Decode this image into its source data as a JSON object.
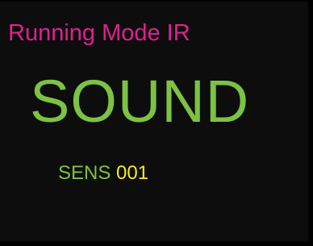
{
  "header": {
    "title": "Running Mode IR"
  },
  "main": {
    "mode_label": "SOUND"
  },
  "sensitivity": {
    "label": "SENS",
    "value": "001"
  },
  "colors": {
    "title": "#e0208f",
    "mode": "#7cc243",
    "sens_label": "#7cc243",
    "sens_value": "#f3eb23",
    "background": "#0d0d0d"
  }
}
